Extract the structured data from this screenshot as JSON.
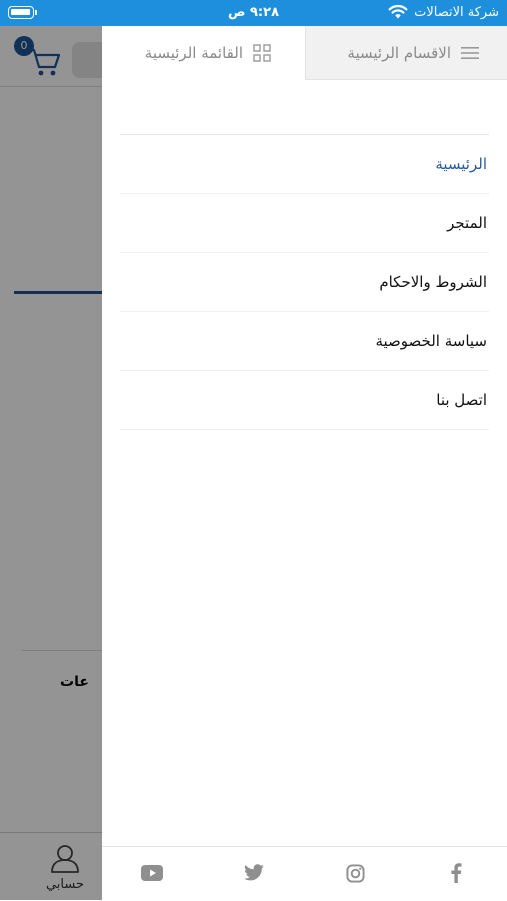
{
  "status_bar": {
    "carrier": "شركة الاتصالات",
    "time": "٩:٢٨ ص"
  },
  "background_app": {
    "cart_count": "0",
    "section_text": "عات",
    "account_label": "حسابي"
  },
  "drawer": {
    "tabs": [
      {
        "label": "الاقسام الرئيسية",
        "icon": "hamburger-icon"
      },
      {
        "label": "القائمة الرئيسية",
        "icon": "grid-icon",
        "active": true
      }
    ],
    "menu_items": [
      {
        "label": "الرئيسية",
        "active": true
      },
      {
        "label": "المتجر"
      },
      {
        "label": "الشروط والاحكام"
      },
      {
        "label": "سياسة الخصوصية"
      },
      {
        "label": "اتصل بنا"
      }
    ],
    "social": [
      "youtube-icon",
      "twitter-icon",
      "instagram-icon",
      "facebook-icon"
    ],
    "colors": {
      "active_item": "#2a5a9c",
      "status_bar": "#1d8fdc"
    }
  }
}
